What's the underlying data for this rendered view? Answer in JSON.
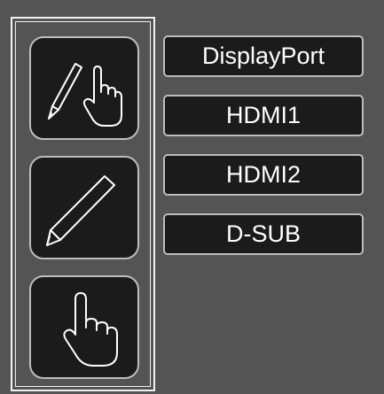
{
  "mode_panel": {
    "buttons": [
      {
        "icon": "pen-and-finger-icon"
      },
      {
        "icon": "pen-icon"
      },
      {
        "icon": "finger-touch-icon"
      }
    ]
  },
  "inputs": [
    {
      "label": "DisplayPort"
    },
    {
      "label": "HDMI1"
    },
    {
      "label": "HDMI2"
    },
    {
      "label": "D-SUB"
    }
  ],
  "colors": {
    "background": "#545454",
    "button_fill": "#1b1b1b",
    "button_border": "#bdbdbd",
    "text": "#ffffff"
  }
}
